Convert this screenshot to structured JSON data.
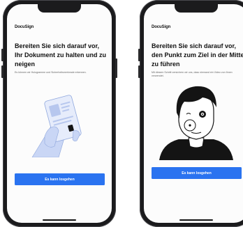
{
  "screens": [
    {
      "logo": "DocuSign",
      "title": "Bereiten Sie sich darauf vor, Ihr Dokument zu halten und zu neigen",
      "subtitle": "Es können wir Hologramme und Sicherheitsmerkmale erkennen.",
      "button_label": "Es kann losgehen",
      "illustration": "hand-holding-id-card"
    },
    {
      "logo": "DocuSign",
      "title": "Bereiten Sie sich darauf vor, den Punkt zum Ziel in der Mitte zu führen",
      "subtitle": "Mit diesem Schritt versichern wir uns, dass niemand ein Video von Ihnen verwendet.",
      "button_label": "Es kann losgehen",
      "illustration": "face-with-target-dot"
    }
  ],
  "colors": {
    "accent": "#2a73f0",
    "illustration_blue": "#c9d6f5",
    "illustration_dark": "#141414"
  }
}
